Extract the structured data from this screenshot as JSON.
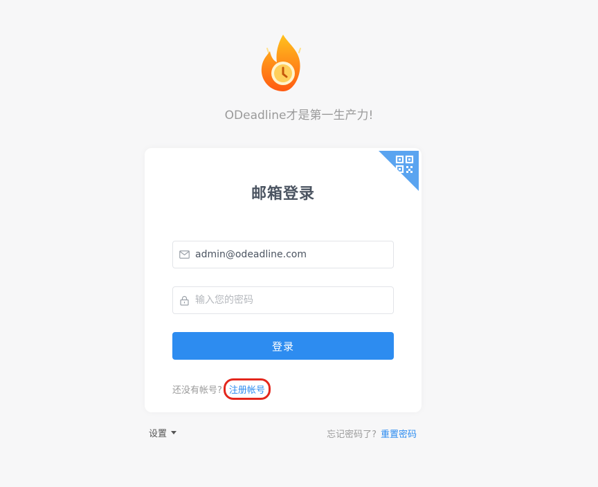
{
  "logo": {
    "icon": "flame-clock-icon"
  },
  "slogan": "ODeadline才是第一生产力!",
  "card": {
    "title": "邮箱登录",
    "qr_icon": "qr-code-icon",
    "email": {
      "value": "admin@odeadline.com",
      "icon": "mail-icon"
    },
    "password": {
      "placeholder": "输入您的密码",
      "icon": "lock-icon"
    },
    "login_button": "登录",
    "register_prompt": "还没有帐号?",
    "register_link": "注册帐号"
  },
  "footer": {
    "settings_label": "设置",
    "forgot_prompt": "忘记密码了?",
    "reset_link": "重置密码"
  },
  "colors": {
    "accent": "#2d8cf0",
    "highlight": "#e3261c",
    "background": "#f7f7f8"
  }
}
